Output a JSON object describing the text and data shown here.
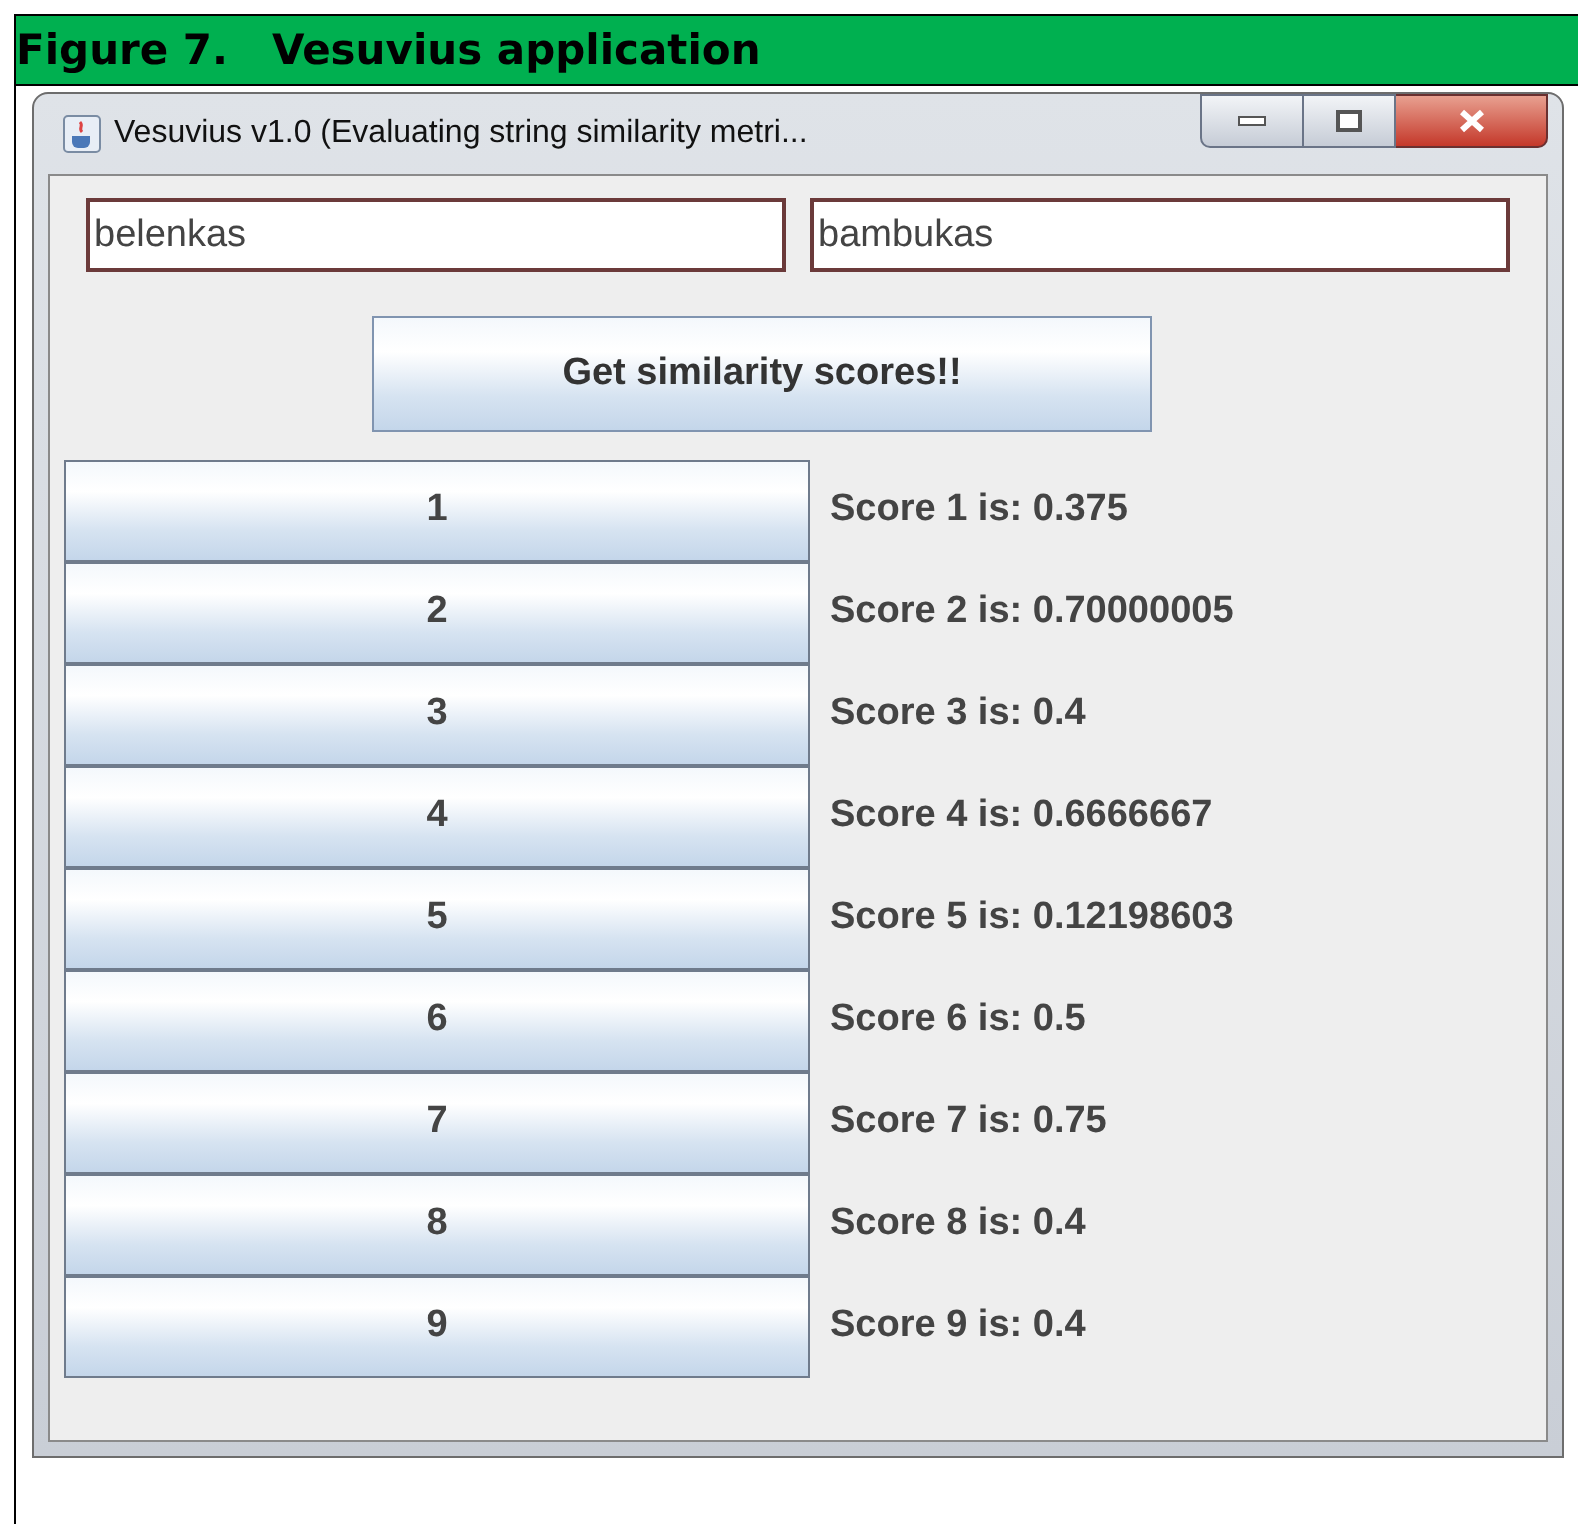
{
  "caption": "Figure 7.   Vesuvius application",
  "window": {
    "title": "Vesuvius v1.0 (Evaluating string similarity metri..."
  },
  "fields": [
    {
      "value": "belenkas"
    },
    {
      "value": "bambukas"
    }
  ],
  "action_button": "Get similarity scores!!",
  "rows": [
    {
      "button": "1",
      "score": "Score 1 is: 0.375"
    },
    {
      "button": "2",
      "score": "Score 2 is: 0.70000005"
    },
    {
      "button": "3",
      "score": "Score 3 is: 0.4"
    },
    {
      "button": "4",
      "score": "Score 4 is: 0.6666667"
    },
    {
      "button": "5",
      "score": "Score 5 is: 0.12198603"
    },
    {
      "button": "6",
      "score": "Score 6 is: 0.5"
    },
    {
      "button": "7",
      "score": "Score 7 is: 0.75"
    },
    {
      "button": "8",
      "score": "Score 8 is: 0.4"
    },
    {
      "button": "9",
      "score": "Score 9 is: 0.4"
    }
  ]
}
